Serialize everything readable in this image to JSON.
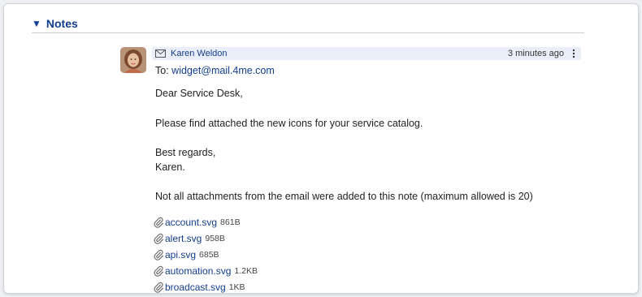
{
  "section": {
    "title": "Notes",
    "toggle_glyph": "▼"
  },
  "note": {
    "author": "Karen Weldon",
    "time_ago": "3 minutes ago",
    "to_label": "To:",
    "to_address": "widget@mail.4me.com",
    "greeting": "Dear Service Desk,",
    "message": "Please find attached the new icons for your service catalog.",
    "closing": "Best regards,",
    "signature": "Karen.",
    "attachment_notice": "Not all attachments from the email were added to this note (maximum allowed is 20)",
    "attachments": [
      {
        "name": "account.svg",
        "size": "861B"
      },
      {
        "name": "alert.svg",
        "size": "958B"
      },
      {
        "name": "api.svg",
        "size": "685B"
      },
      {
        "name": "automation.svg",
        "size": "1.2KB"
      },
      {
        "name": "broadcast.svg",
        "size": "1KB"
      }
    ]
  },
  "icons": {
    "header_mail": "envelope-icon",
    "menu": "kebab-menu-icon",
    "attachment": "paperclip-icon"
  },
  "colors": {
    "link": "#123d8c",
    "header_bg": "#eaeef8"
  }
}
